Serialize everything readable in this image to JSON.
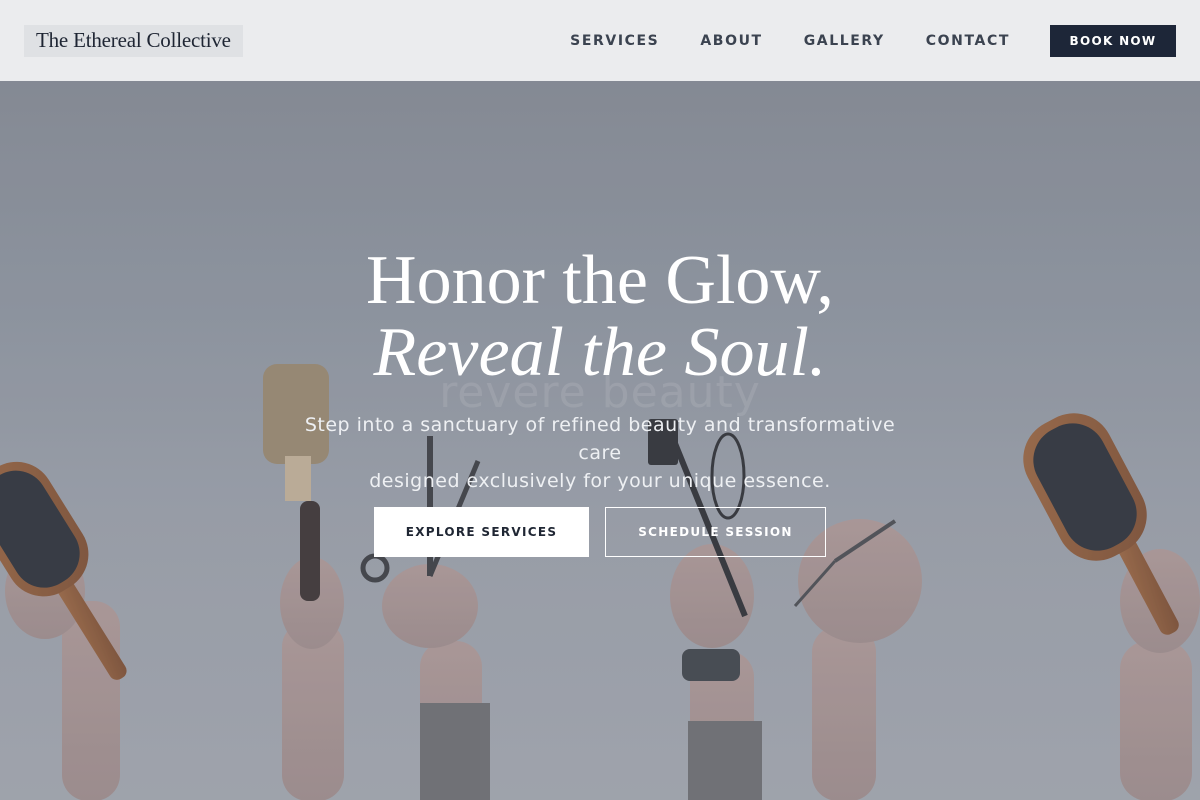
{
  "header": {
    "logo": "The Ethereal Collective",
    "nav": [
      "SERVICES",
      "ABOUT",
      "GALLERY",
      "CONTACT"
    ],
    "cta": "BOOK NOW"
  },
  "hero": {
    "title_line1": "Honor the Glow,",
    "title_line2": "Reveal the Soul.",
    "ghost_text": "revere beauty",
    "subtitle_line1": "Step into a sanctuary of refined beauty and transformative care",
    "subtitle_line2": "designed exclusively for your unique essence.",
    "primary_button": "EXPLORE SERVICES",
    "secondary_button": "SCHEDULE SESSION",
    "photo_icon": "hands-holding-hair-tools-photo"
  },
  "colors": {
    "header_bg": "#ebecee",
    "navy": "#1d2638",
    "hero_overlay": "#8e939d",
    "white": "#ffffff"
  }
}
